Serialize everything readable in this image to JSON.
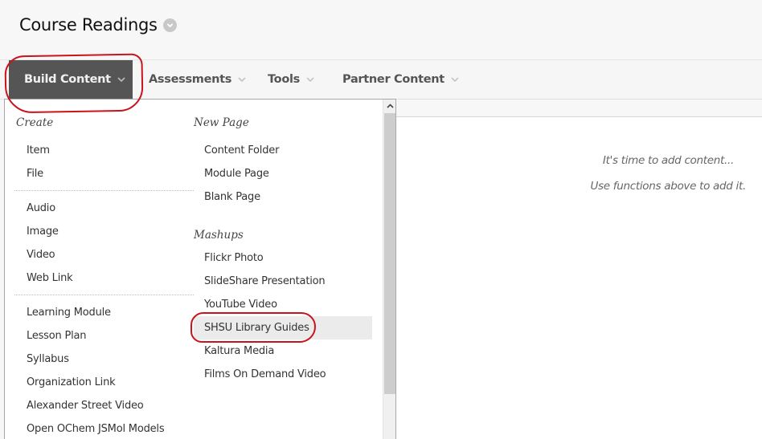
{
  "page": {
    "title": "Course Readings",
    "title_menu_icon": "chevron-down-circle-icon"
  },
  "action_bar": {
    "items": [
      {
        "label": "Build Content",
        "active": true,
        "icon": "chevron-down-icon"
      },
      {
        "label": "Assessments",
        "active": false,
        "icon": "chevron-down-icon"
      },
      {
        "label": "Tools",
        "active": false,
        "icon": "chevron-down-icon"
      },
      {
        "label": "Partner Content",
        "active": false,
        "icon": "chevron-down-icon"
      }
    ]
  },
  "dropdown": {
    "create": {
      "heading": "Create",
      "groups": [
        [
          "Item",
          "File"
        ],
        [
          "Audio",
          "Image",
          "Video",
          "Web Link"
        ],
        [
          "Learning Module",
          "Lesson Plan",
          "Syllabus",
          "Organization Link",
          "Alexander Street Video",
          "Open OChem JSMol Models"
        ]
      ]
    },
    "new_page": {
      "heading": "New Page",
      "items": [
        "Content Folder",
        "Module Page",
        "Blank Page"
      ]
    },
    "mashups": {
      "heading": "Mashups",
      "items": [
        "Flickr Photo",
        "SlideShare Presentation",
        "YouTube Video",
        "SHSU Library Guides",
        "Kaltura Media",
        "Films On Demand Video"
      ],
      "highlighted": "SHSU Library Guides"
    },
    "scroll_up_icon": "chevron-up-icon"
  },
  "content_area": {
    "empty_line1": "It's time to add content...",
    "empty_line2": "Use functions above to add it."
  },
  "colors": {
    "active_tab_bg": "#555555",
    "annotation_red": "#c8141c",
    "highlight_bg": "#ebebeb"
  }
}
